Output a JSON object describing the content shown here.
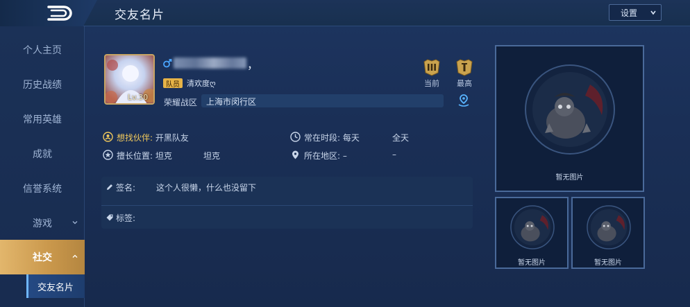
{
  "header": {
    "title": "交友名片",
    "settings_label": "设置"
  },
  "sidebar": {
    "items": [
      {
        "label": "个人主页"
      },
      {
        "label": "历史战绩"
      },
      {
        "label": "常用英雄"
      },
      {
        "label": "成就"
      },
      {
        "label": "信誉系统"
      },
      {
        "label": "游戏"
      },
      {
        "label": "社交"
      }
    ],
    "sub_item": "交友名片"
  },
  "profile": {
    "level": "Lv.30",
    "name_tail": "，",
    "role_badge": "队员",
    "role_text": "清欢度ღ",
    "server_label": "荣耀战区",
    "server_value": "上海市闵行区",
    "rank_current_label": "当前",
    "rank_best_label": "最高"
  },
  "info": {
    "partner_label": "想找伙伴:",
    "partner_value": "开黑队友",
    "time_label": "常在时段:",
    "time_value_1": "每天",
    "time_value_2": "全天",
    "position_label": "擅长位置:",
    "position_value_1": "坦克",
    "position_value_2": "坦克",
    "region_label": "所在地区:",
    "region_value_1": "–",
    "region_value_2": "–"
  },
  "signature": {
    "label": "签名:",
    "value": "这个人很懒，什么也没留下",
    "tags_label": "标签:"
  },
  "photos": {
    "empty_caption": "暂无图片",
    "count": 3
  },
  "colors": {
    "accent_gold": "#e2b66c",
    "badge_yellow": "#e6b347",
    "link_blue": "#6fb6ff"
  }
}
